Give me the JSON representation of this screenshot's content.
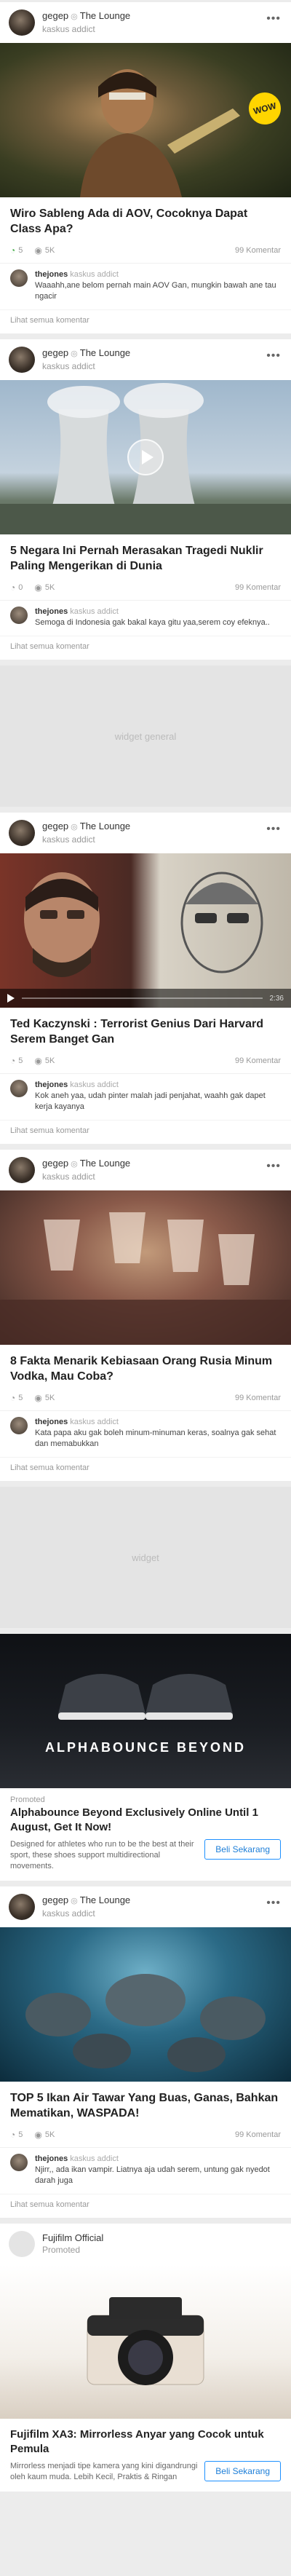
{
  "feed": [
    {
      "kind": "post",
      "user": "gegep",
      "channel": "The Lounge",
      "rank": "kaskus addict",
      "title": "Wiro Sableng Ada di AOV, Cocoknya Dapat Class Apa?",
      "badge": "WOW",
      "share_count": "5",
      "views": "5K",
      "comments_count": "99 Komentar",
      "comment": {
        "user": "thejones",
        "rank": "kaskus addict",
        "text": "Waaahh,ane belom pernah main AOV Gan, mungkin bawah ane tau ngacir"
      },
      "see_all": "Lihat semua komentar"
    },
    {
      "kind": "post",
      "user": "gegep",
      "channel": "The Lounge",
      "rank": "kaskus addict",
      "title": "5 Negara Ini Pernah Merasakan Tragedi Nuklir Paling Mengerikan di Dunia",
      "share_count": "0",
      "views": "5K",
      "comments_count": "99 Komentar",
      "comment": {
        "user": "thejones",
        "rank": "kaskus addict",
        "text": "Semoga di Indonesia gak bakal kaya gitu yaa,serem coy efeknya.."
      },
      "see_all": "Lihat semua komentar"
    },
    {
      "kind": "widget",
      "label": "widget general"
    },
    {
      "kind": "post",
      "user": "gegep",
      "channel": "The Lounge",
      "rank": "kaskus addict",
      "title": "Ted Kaczynski : Terrorist Genius Dari Harvard Serem Banget Gan",
      "video_time": "2:36",
      "share_count": "5",
      "views": "5K",
      "comments_count": "99 Komentar",
      "comment": {
        "user": "thejones",
        "rank": "kaskus addict",
        "text": "Kok aneh yaa, udah pinter malah jadi penjahat, waahh gak dapet kerja kayanya"
      },
      "see_all": "Lihat semua komentar"
    },
    {
      "kind": "post",
      "user": "gegep",
      "channel": "The Lounge",
      "rank": "kaskus addict",
      "title": "8 Fakta Menarik Kebiasaan Orang Rusia Minum Vodka, Mau Coba?",
      "share_count": "5",
      "views": "5K",
      "comments_count": "99 Komentar",
      "comment": {
        "user": "thejones",
        "rank": "kaskus addict",
        "text": "Kata papa aku gak boleh minum-minuman keras, soalnya gak sehat dan memabukkan"
      },
      "see_all": "Lihat semua komentar"
    },
    {
      "kind": "widget",
      "label": "widget"
    },
    {
      "kind": "promo",
      "image_text": "ALPHABOUNCE BEYOND",
      "label": "Promoted",
      "title": "Alphabounce Beyond Exclusively Online Until 1 August, Get It Now!",
      "desc": "Designed for athletes who run to be the best at their sport, these shoes support multidirectional movements.",
      "button": "Beli Sekarang"
    },
    {
      "kind": "post",
      "user": "gegep",
      "channel": "The Lounge",
      "rank": "kaskus addict",
      "title": "TOP 5 Ikan Air Tawar Yang Buas, Ganas, Bahkan Mematikan, WASPADA!",
      "share_count": "5",
      "views": "5K",
      "comments_count": "99 Komentar",
      "comment": {
        "user": "thejones",
        "rank": "kaskus addict",
        "text": "Njirr,, ada ikan vampir. Liatnya aja udah serem, untung gak nyedot darah juga"
      },
      "see_all": "Lihat semua komentar"
    },
    {
      "kind": "brand",
      "brand": "Fujifilm Official",
      "label": "Promoted",
      "title": "Fujifilm XA3: Mirrorless Anyar yang Cocok untuk Pemula",
      "desc": "Mirrorless menjadi tipe kamera yang kini digandrungi oleh kaum muda. Lebih Kecil, Praktis & Ringan",
      "button": "Beli Sekarang"
    }
  ],
  "icons": {
    "more": "more-dots-icon",
    "share": "share-icon",
    "views": "eye-icon",
    "play": "play-icon"
  }
}
